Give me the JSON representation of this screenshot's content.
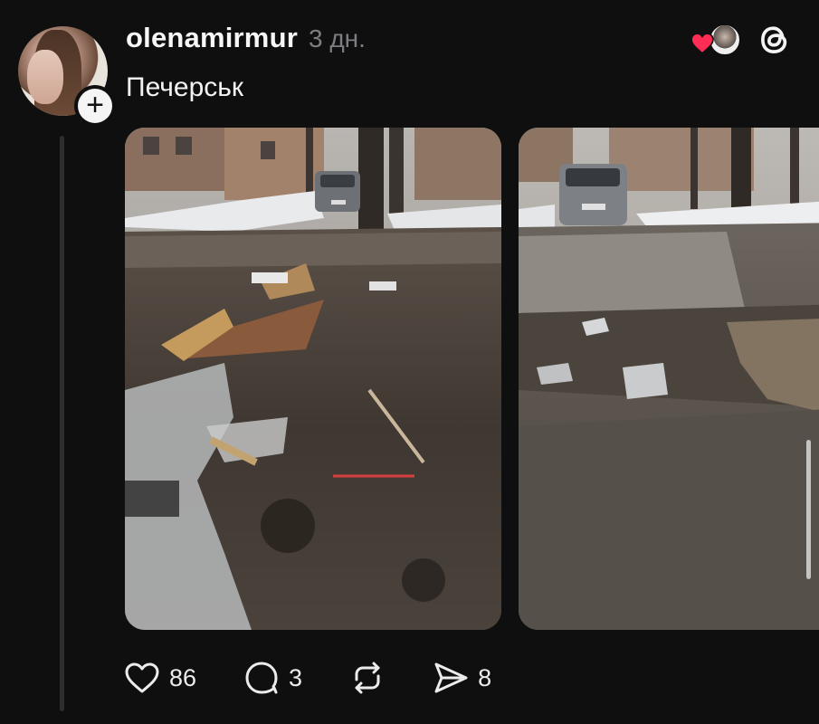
{
  "post": {
    "username": "olenamirmur",
    "time": "3 дн.",
    "caption": "Печерськ",
    "likes": "86",
    "comments": "3",
    "shares": "8"
  },
  "icons": {
    "like": "heart-outline-icon",
    "comment": "speech-bubble-icon",
    "repost": "repost-arrows-icon",
    "share": "paper-plane-icon",
    "brand": "threads-logo-icon",
    "follow": "plus-icon"
  },
  "colors": {
    "background": "#0f0f10",
    "text": "#f3f3f3",
    "muted": "#7d7d82",
    "like_red": "#ff2d55"
  }
}
